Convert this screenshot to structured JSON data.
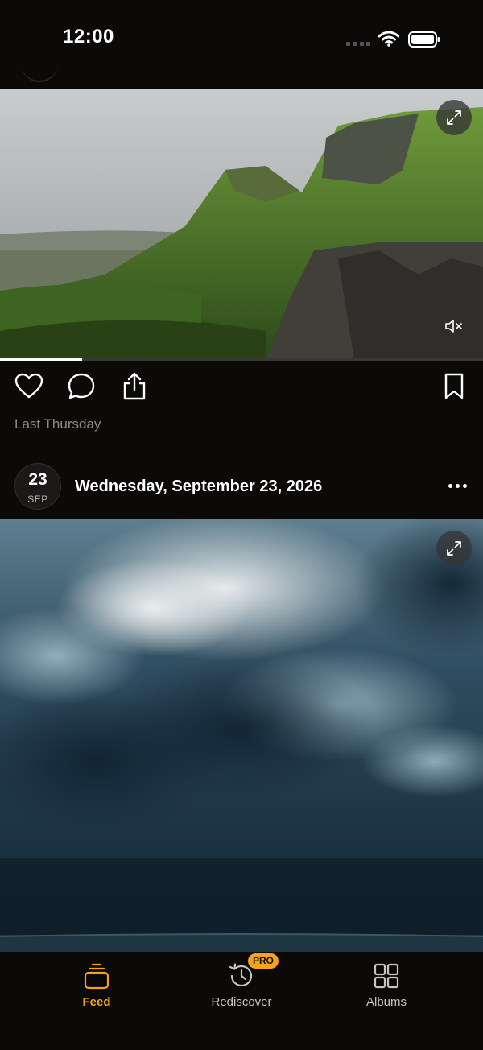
{
  "status_bar": {
    "time": "12:00"
  },
  "feed": {
    "post_1": {
      "scene": "green-mountain-cliffs-landscape",
      "video_progress": 0.17,
      "timestamp": "Last Thursday"
    },
    "post_2": {
      "date_day": "23",
      "date_month": "SEP",
      "date_full": "Wednesday, September 23, 2026",
      "scene": "stormy-clouds-sky"
    }
  },
  "tab_bar": {
    "tabs": [
      {
        "label": "Feed",
        "icon": "feed-icon",
        "active": true
      },
      {
        "label": "Rediscover",
        "icon": "history-clock-icon",
        "active": false,
        "badge": "PRO"
      },
      {
        "label": "Albums",
        "icon": "grid-icon",
        "active": false
      }
    ]
  },
  "colors": {
    "accent": "#f6a21b",
    "background": "#0b0a09",
    "muted_text": "#8d8a86"
  }
}
